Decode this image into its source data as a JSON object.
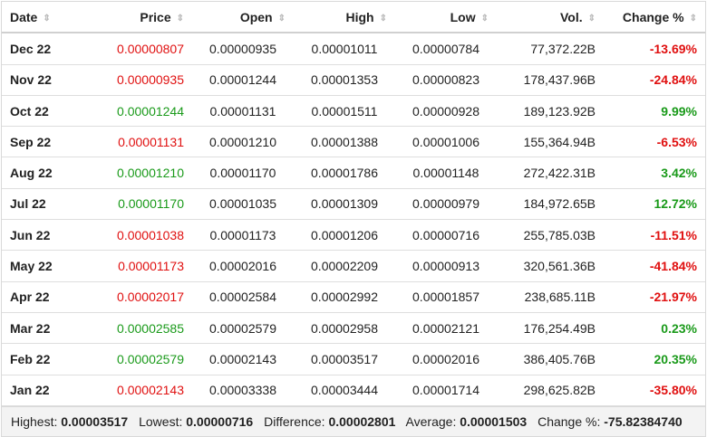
{
  "headers": {
    "date": "Date",
    "price": "Price",
    "open": "Open",
    "high": "High",
    "low": "Low",
    "vol": "Vol.",
    "change": "Change %"
  },
  "sort_icon": "sort-updown-icon",
  "colors": {
    "up": "#1a9a1a",
    "down": "#e01010"
  },
  "rows": [
    {
      "date": "Dec 22",
      "price": "0.00000807",
      "open": "0.00000935",
      "high": "0.00001011",
      "low": "0.00000784",
      "vol": "77,372.22B",
      "change": "-13.69%",
      "dir": "down"
    },
    {
      "date": "Nov 22",
      "price": "0.00000935",
      "open": "0.00001244",
      "high": "0.00001353",
      "low": "0.00000823",
      "vol": "178,437.96B",
      "change": "-24.84%",
      "dir": "down"
    },
    {
      "date": "Oct 22",
      "price": "0.00001244",
      "open": "0.00001131",
      "high": "0.00001511",
      "low": "0.00000928",
      "vol": "189,123.92B",
      "change": "9.99%",
      "dir": "up"
    },
    {
      "date": "Sep 22",
      "price": "0.00001131",
      "open": "0.00001210",
      "high": "0.00001388",
      "low": "0.00001006",
      "vol": "155,364.94B",
      "change": "-6.53%",
      "dir": "down"
    },
    {
      "date": "Aug 22",
      "price": "0.00001210",
      "open": "0.00001170",
      "high": "0.00001786",
      "low": "0.00001148",
      "vol": "272,422.31B",
      "change": "3.42%",
      "dir": "up"
    },
    {
      "date": "Jul 22",
      "price": "0.00001170",
      "open": "0.00001035",
      "high": "0.00001309",
      "low": "0.00000979",
      "vol": "184,972.65B",
      "change": "12.72%",
      "dir": "up"
    },
    {
      "date": "Jun 22",
      "price": "0.00001038",
      "open": "0.00001173",
      "high": "0.00001206",
      "low": "0.00000716",
      "vol": "255,785.03B",
      "change": "-11.51%",
      "dir": "down"
    },
    {
      "date": "May 22",
      "price": "0.00001173",
      "open": "0.00002016",
      "high": "0.00002209",
      "low": "0.00000913",
      "vol": "320,561.36B",
      "change": "-41.84%",
      "dir": "down"
    },
    {
      "date": "Apr 22",
      "price": "0.00002017",
      "open": "0.00002584",
      "high": "0.00002992",
      "low": "0.00001857",
      "vol": "238,685.11B",
      "change": "-21.97%",
      "dir": "down"
    },
    {
      "date": "Mar 22",
      "price": "0.00002585",
      "open": "0.00002579",
      "high": "0.00002958",
      "low": "0.00002121",
      "vol": "176,254.49B",
      "change": "0.23%",
      "dir": "up"
    },
    {
      "date": "Feb 22",
      "price": "0.00002579",
      "open": "0.00002143",
      "high": "0.00003517",
      "low": "0.00002016",
      "vol": "386,405.76B",
      "change": "20.35%",
      "dir": "up"
    },
    {
      "date": "Jan 22",
      "price": "0.00002143",
      "open": "0.00003338",
      "high": "0.00003444",
      "low": "0.00001714",
      "vol": "298,625.82B",
      "change": "-35.80%",
      "dir": "down"
    }
  ],
  "summary": {
    "highest_label": "Highest:",
    "highest": "0.00003517",
    "lowest_label": "Lowest:",
    "lowest": "0.00000716",
    "difference_label": "Difference:",
    "difference": "0.00002801",
    "average_label": "Average:",
    "average": "0.00001503",
    "change_label": "Change %:",
    "change": "-75.82384740"
  }
}
